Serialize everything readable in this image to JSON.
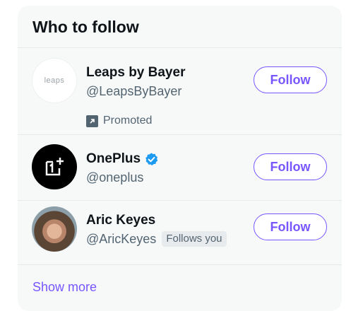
{
  "widget": {
    "title": "Who to follow",
    "show_more_label": "Show more",
    "accent_color": "#7856ff"
  },
  "users": [
    {
      "display_name": "Leaps by Bayer",
      "handle": "@LeapsByBayer",
      "avatar_text": "leaps",
      "promoted_label": "Promoted",
      "follow_label": "Follow"
    },
    {
      "display_name": "OnePlus",
      "handle": "@oneplus",
      "verified": true,
      "follow_label": "Follow"
    },
    {
      "display_name": "Aric Keyes",
      "handle": "@AricKeyes",
      "follows_you_label": "Follows you",
      "follow_label": "Follow"
    }
  ]
}
